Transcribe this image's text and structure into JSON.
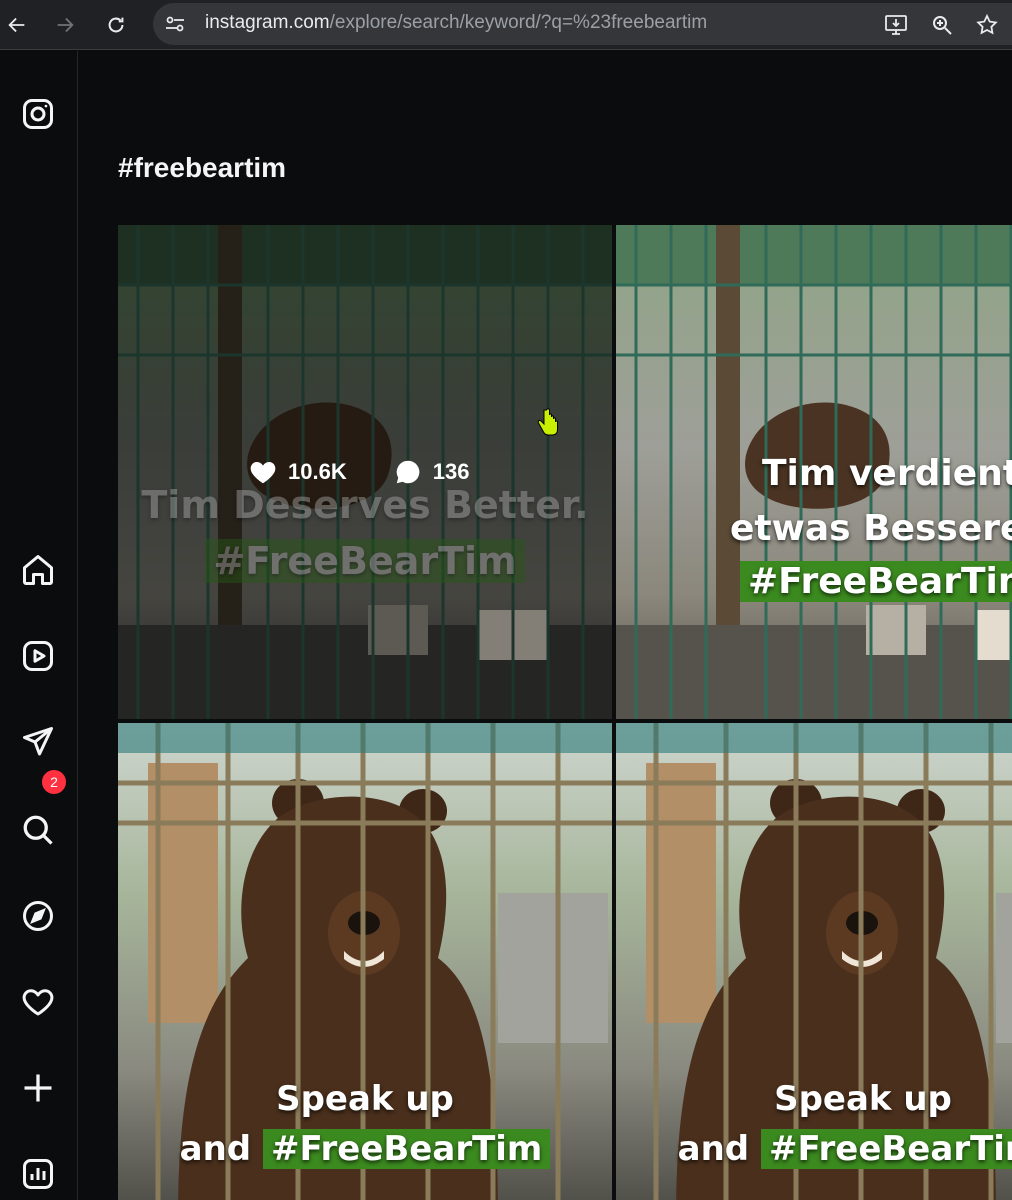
{
  "browser": {
    "url_host": "instagram.com",
    "url_path": "/explore/search/keyword/?q=%23freebeartim"
  },
  "page": {
    "title": "#freebeartim"
  },
  "sidebar": {
    "notifications_badge": "2"
  },
  "posts": [
    {
      "caption_line1": "Tim Deserves Better.",
      "caption_tag": "#FreeBearTim",
      "likes": "10.6K",
      "comments": "136",
      "hovered": true
    },
    {
      "caption_line1": "Tim verdient",
      "caption_line2": "etwas Besseres",
      "caption_tag": "#FreeBearTim"
    },
    {
      "caption_line1": "Speak up",
      "caption_line2_prefix": "and",
      "caption_tag": "#FreeBearTim"
    },
    {
      "caption_line1": "Speak up",
      "caption_line2_prefix": "and",
      "caption_tag": "#FreeBearTim"
    }
  ],
  "colors": {
    "tag_highlight": "#3b8a1f",
    "badge": "#ff3040",
    "background": "#0b0c0e"
  }
}
